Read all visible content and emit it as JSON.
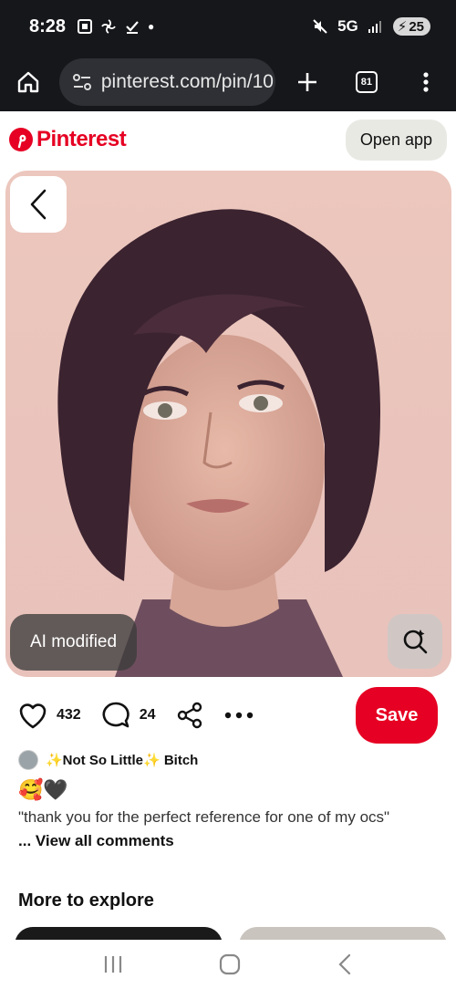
{
  "status": {
    "time": "8:28",
    "network": "5G",
    "battery": "25"
  },
  "browser": {
    "url": "pinterest.com/pin/10",
    "tab_count": "81"
  },
  "header": {
    "logo_text": "Pinterest",
    "open_app_label": "Open app"
  },
  "pin": {
    "ai_badge": "AI modified"
  },
  "actions": {
    "likes": "432",
    "comments": "24",
    "save_label": "Save"
  },
  "comment": {
    "user": "✨Not So Little✨ Bitch",
    "emoji": "🥰🖤",
    "text": "\"thank you for the perfect reference for one of my ocs\"",
    "view_all": "... View all comments"
  },
  "more": {
    "heading": "More to explore"
  },
  "colors": {
    "brand": "#e60023",
    "dark": "#16171b"
  }
}
